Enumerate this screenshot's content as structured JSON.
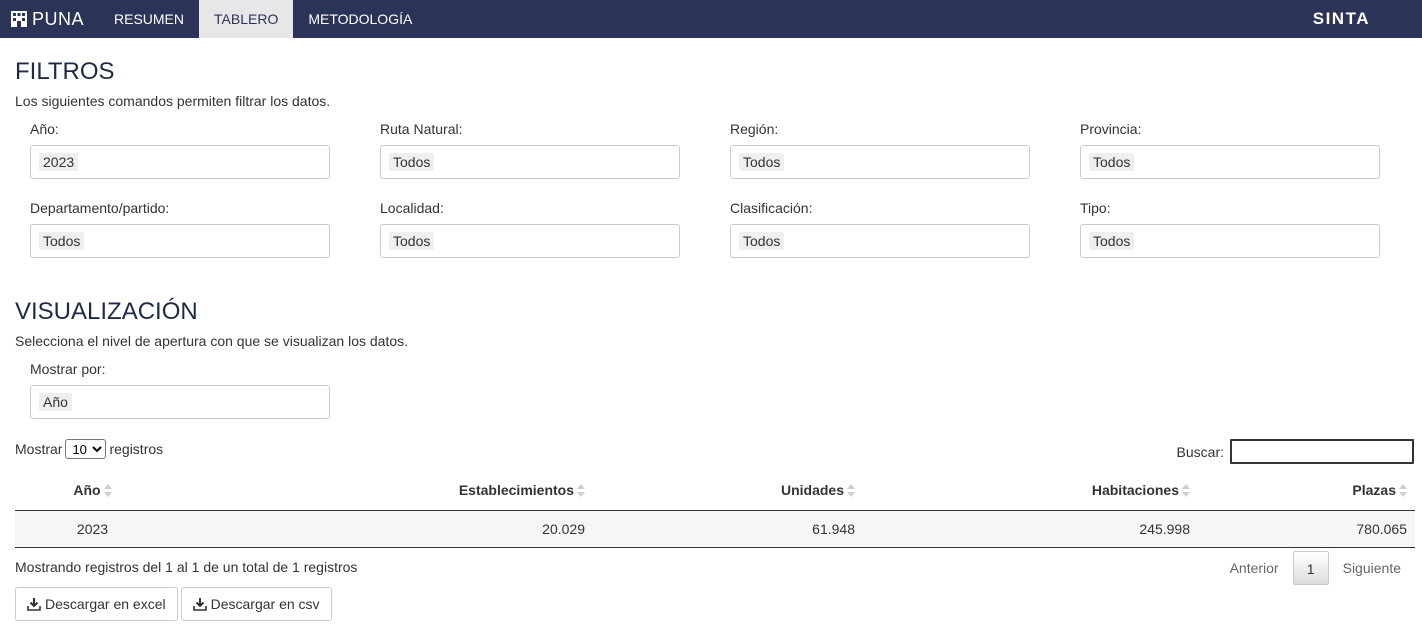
{
  "navbar": {
    "brand": "PUNA",
    "brand_icon": "building-icon",
    "tabs": [
      {
        "label": "RESUMEN",
        "active": false
      },
      {
        "label": "TABLERO",
        "active": true
      },
      {
        "label": "METODOLOGÍA",
        "active": false
      }
    ],
    "right_title": "SINTA",
    "bg_color": "#2c3358",
    "active_tab_color": "#e7e7e7"
  },
  "filtros": {
    "title": "FILTROS",
    "description": "Los siguientes comandos permiten filtrar los datos.",
    "fields": [
      {
        "label": "Año:",
        "value": "2023"
      },
      {
        "label": "Ruta Natural:",
        "value": "Todos"
      },
      {
        "label": "Región:",
        "value": "Todos"
      },
      {
        "label": "Provincia:",
        "value": "Todos"
      },
      {
        "label": "Departamento/partido:",
        "value": "Todos"
      },
      {
        "label": "Localidad:",
        "value": "Todos"
      },
      {
        "label": "Clasificación:",
        "value": "Todos"
      },
      {
        "label": "Tipo:",
        "value": "Todos"
      }
    ]
  },
  "visualizacion": {
    "title": "VISUALIZACIÓN",
    "description": "Selecciona el nivel de apertura con que se visualizan los datos.",
    "mostrar_por_label": "Mostrar por:",
    "mostrar_por_value": "Año"
  },
  "table_controls": {
    "length_prefix": "Mostrar",
    "length_value": "10",
    "length_suffix": "registros",
    "search_label": "Buscar:"
  },
  "table": {
    "columns": [
      "Año",
      "Establecimientos",
      "Unidades",
      "Habitaciones",
      "Plazas"
    ],
    "rows": [
      [
        "2023",
        "20.029",
        "61.948",
        "245.998",
        "780.065"
      ]
    ]
  },
  "footer": {
    "info": "Mostrando registros del 1 al 1 de un total de 1 registros",
    "prev": "Anterior",
    "page": "1",
    "next": "Siguiente",
    "download_excel": "Descargar en excel",
    "download_csv": "Descargar en csv"
  }
}
